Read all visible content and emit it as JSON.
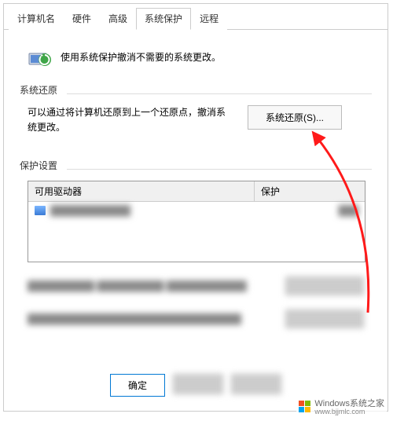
{
  "tabs": {
    "computer_name": "计算机名",
    "hardware": "硬件",
    "advanced": "高级",
    "system_protection": "系统保护",
    "remote": "远程"
  },
  "header": {
    "text": "使用系统保护撤消不需要的系统更改。"
  },
  "restore_section": {
    "title": "系统还原",
    "description": "可以通过将计算机还原到上一个还原点，撤消系统更改。",
    "button": "系统还原(S)..."
  },
  "protection_section": {
    "title": "保护设置",
    "col_drive": "可用驱动器",
    "col_protection": "保护"
  },
  "footer": {
    "ok": "确定"
  },
  "watermark": {
    "brand": "Windows",
    "line2": "系统之家",
    "url": "www.bjjmlc.com"
  }
}
